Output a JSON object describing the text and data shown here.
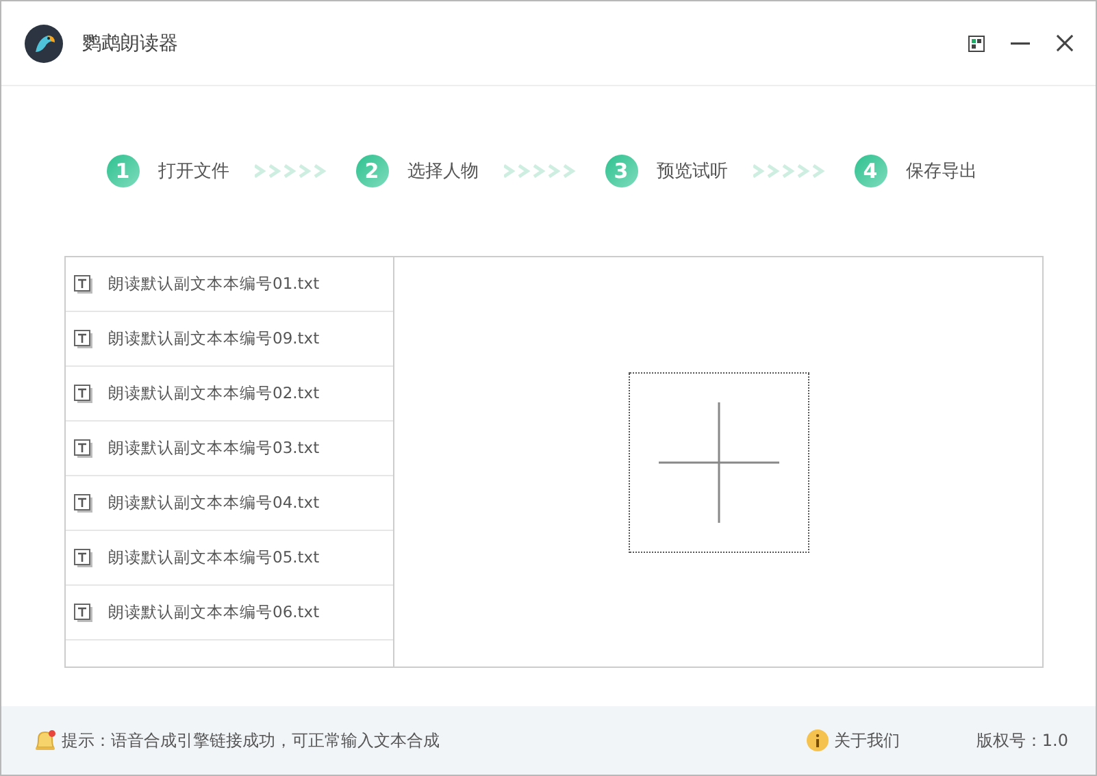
{
  "window": {
    "title": "鹦鹉朗读器"
  },
  "steps": [
    {
      "number": "1",
      "label": "打开文件"
    },
    {
      "number": "2",
      "label": "选择人物"
    },
    {
      "number": "3",
      "label": "预览试听"
    },
    {
      "number": "4",
      "label": "保存导出"
    }
  ],
  "files": [
    "朗读默认副文本本编号01.txt",
    "朗读默认副文本本编号09.txt",
    "朗读默认副文本本编号02.txt",
    "朗读默认副文本本编号03.txt",
    "朗读默认副文本本编号04.txt",
    "朗读默认副文本本编号05.txt",
    "朗读默认副文本本编号06.txt"
  ],
  "status_bar": {
    "tip": "提示：语音合成引擎链接成功，可正常输入文本合成",
    "about": "关于我们",
    "version": "版权号：1.0"
  }
}
